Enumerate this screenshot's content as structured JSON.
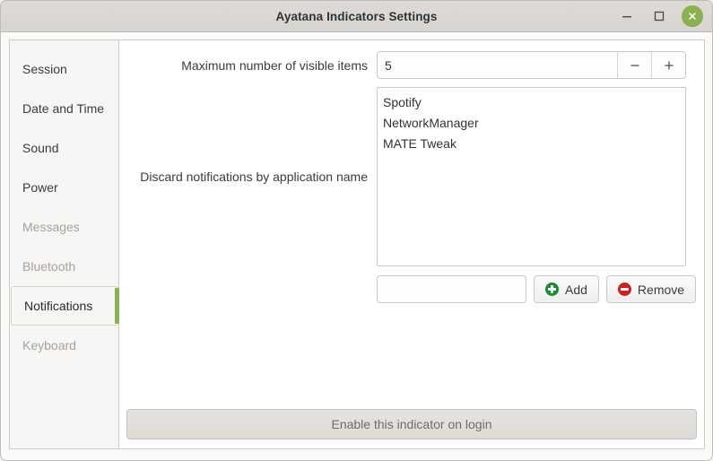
{
  "window": {
    "title": "Ayatana Indicators Settings",
    "controls": {
      "minimize": "minimize",
      "maximize": "maximize",
      "close": "close"
    }
  },
  "sidebar": {
    "items": [
      {
        "label": "Session",
        "state": "enabled"
      },
      {
        "label": "Date and Time",
        "state": "enabled"
      },
      {
        "label": "Sound",
        "state": "enabled"
      },
      {
        "label": "Power",
        "state": "enabled"
      },
      {
        "label": "Messages",
        "state": "disabled"
      },
      {
        "label": "Bluetooth",
        "state": "disabled"
      },
      {
        "label": "Notifications",
        "state": "selected"
      },
      {
        "label": "Keyboard",
        "state": "disabled"
      }
    ],
    "accent_color": "#8cb152"
  },
  "main": {
    "max_items": {
      "label": "Maximum number of visible items",
      "value": "5",
      "decrement": "−",
      "increment": "+"
    },
    "discard": {
      "label": "Discard notifications by application name",
      "items": [
        "Spotify",
        "NetworkManager",
        "MATE Tweak"
      ]
    },
    "actions": {
      "input_value": "",
      "input_placeholder": "",
      "add_label": "Add",
      "remove_label": "Remove",
      "add_icon_color": "#1a8a33",
      "remove_icon_color": "#cc2222"
    },
    "enable_on_login_label": "Enable this indicator on login"
  }
}
